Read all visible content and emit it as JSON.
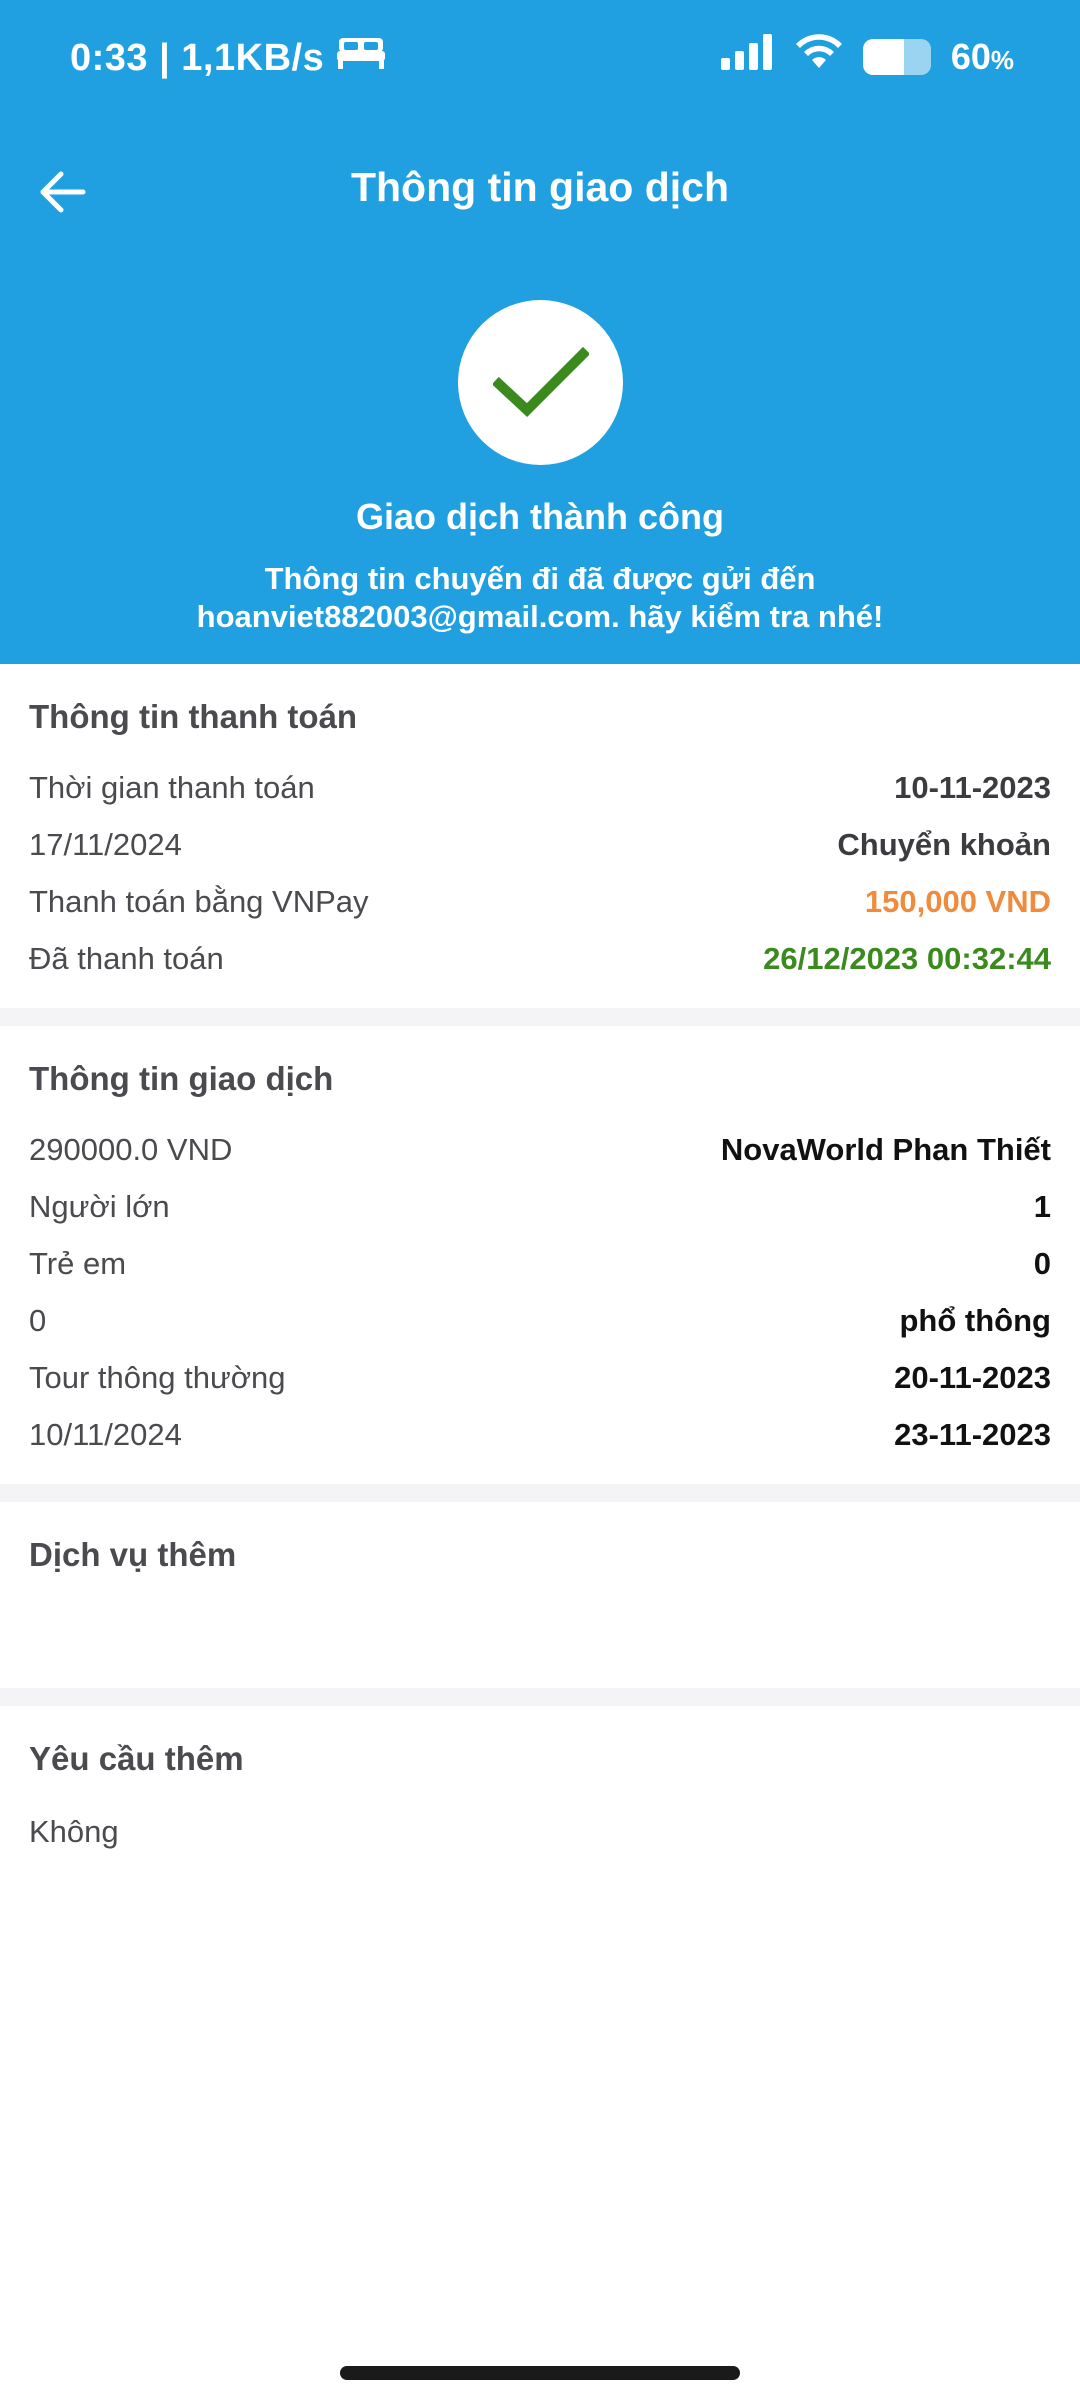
{
  "status_bar": {
    "time_speed": "0:33 | 1,1KB/s",
    "battery_level": 60,
    "battery_text": "60",
    "battery_unit": "%",
    "icons": [
      "bed-icon",
      "signal-icon",
      "wifi-icon",
      "battery-icon"
    ]
  },
  "header": {
    "title": "Thông tin giao dịch",
    "back_icon": "arrow-left-icon",
    "success_icon": "checkmark-icon",
    "success_title": "Giao dịch thành công",
    "success_message_line1": "Thông tin chuyến đi đã được gửi đến",
    "success_message_line2": "hoanviet882003@gmail.com. hãy kiểm tra nhé!",
    "colors": {
      "background": "#20a0e0",
      "check": "#3a8a1e"
    }
  },
  "payment": {
    "title": "Thông tin thanh toán",
    "rows": [
      {
        "label": "Thời gian thanh toán",
        "value": "10-11-2023"
      },
      {
        "label": "17/11/2024",
        "value": "Chuyển khoản"
      },
      {
        "label": "Thanh toán bằng VNPay",
        "value": "150,000 VND"
      },
      {
        "label": "Đã thanh toán",
        "value": "26/12/2023 00:32:44"
      }
    ],
    "colors": {
      "amount": "#f08a3c",
      "paid": "#3a8a1e"
    }
  },
  "transaction": {
    "title": "Thông tin giao dịch",
    "rows": [
      {
        "label": "290000.0 VND",
        "value": "NovaWorld Phan Thiết"
      },
      {
        "label": "Người lớn",
        "value": "1"
      },
      {
        "label": "Trẻ em",
        "value": "0"
      },
      {
        "label": "0",
        "value": "phổ thông"
      },
      {
        "label": "Tour thông thường",
        "value": "20-11-2023"
      },
      {
        "label": "10/11/2024",
        "value": "23-11-2023"
      }
    ]
  },
  "extra_services": {
    "title": "Dịch vụ thêm"
  },
  "extra_requests": {
    "title": "Yêu cầu thêm",
    "value": "Không"
  }
}
